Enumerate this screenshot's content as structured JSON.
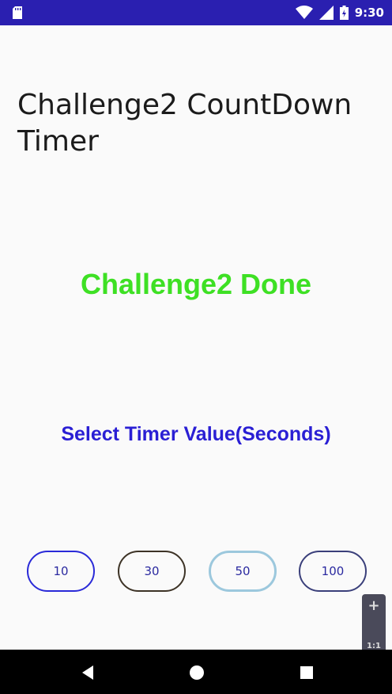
{
  "status_bar": {
    "time": "9:30",
    "icons": [
      "sd-card-icon",
      "wifi-icon",
      "signal-icon",
      "battery-icon"
    ]
  },
  "app": {
    "title": "Challenge2 CountDown Timer",
    "status_message": "Challenge2 Done",
    "select_label": "Select Timer Value(Seconds)",
    "timer_options": [
      "10",
      "30",
      "50",
      "100"
    ]
  },
  "zoom_widget": {
    "plus": "+",
    "ratio": "1:1"
  },
  "colors": {
    "status_bar": "#2a1fb0",
    "status_message": "#3ee024",
    "select_label": "#2a1fd4"
  }
}
